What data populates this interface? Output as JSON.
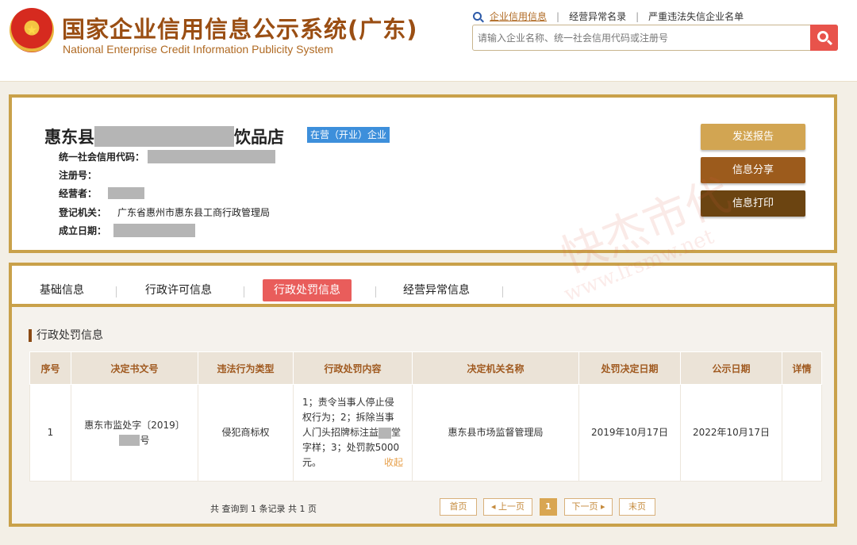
{
  "header": {
    "emblem_glyph": "★",
    "title": "国家企业信用信息公示系统(广东)",
    "subtitle": "National Enterprise Credit Information Publicity System",
    "links": [
      "企业信用信息",
      "经营异常名录",
      "严重违法失信企业名单"
    ],
    "search_placeholder": "请输入企业名称、统一社会信用代码或注册号"
  },
  "company": {
    "name_prefix": "惠东县",
    "name_suffix": "饮品店",
    "status": "在营（开业）企业",
    "fields": [
      {
        "label": "统一社会信用代码：",
        "value": ""
      },
      {
        "label": "注册号：",
        "value": ""
      },
      {
        "label": "经营者：",
        "value": ""
      },
      {
        "label": "登记机关：",
        "value": "广东省惠州市惠东县工商行政管理局"
      },
      {
        "label": "成立日期：",
        "value": ""
      }
    ],
    "actions": {
      "send": "发送报告",
      "share": "信息分享",
      "print": "信息打印"
    }
  },
  "watermark": {
    "line1": "快杰市代",
    "line2": "www.lrsmw.net"
  },
  "tabs": [
    "基础信息",
    "行政许可信息",
    "行政处罚信息",
    "经营异常信息"
  ],
  "active_tab": "行政处罚信息",
  "section_title": "行政处罚信息",
  "table": {
    "headers": [
      "序号",
      "决定书文号",
      "违法行为类型",
      "行政处罚内容",
      "决定机关名称",
      "处罚决定日期",
      "公示日期",
      "详情"
    ],
    "row": {
      "index": "1",
      "doc_no_line1": "惠东市监处字〔2019〕",
      "doc_no_line2": "号",
      "violation": "侵犯商标权",
      "content_part1": "1；责令当事人停止侵权行为；2；拆除当事人门头招牌标注益",
      "content_part2": "堂字样；3；处罚款5000元。",
      "collapse": "收起",
      "authority": "惠东县市场监督管理局",
      "decision_date": "2019年10月17日",
      "publish_date": "2022年10月17日",
      "detail": ""
    }
  },
  "pagination": {
    "summary": "共 查询到 1 条记录 共 1 页",
    "first": "首页",
    "prev": "◂ 上一页",
    "current": "1",
    "next": "下一页 ▸",
    "last": "末页"
  }
}
